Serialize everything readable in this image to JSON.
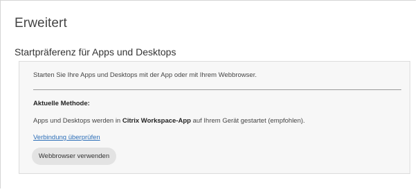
{
  "page": {
    "title": "Erweitert"
  },
  "section": {
    "title": "Startpräferenz für Apps und Desktops"
  },
  "panel": {
    "intro": "Starten Sie Ihre Apps und Desktops mit der App oder mit Ihrem Webbrowser.",
    "method_label": "Aktuelle Methode:",
    "method_text_prefix": "Apps und Desktops werden in ",
    "method_text_app": "Citrix Workspace-App",
    "method_text_suffix": " auf Ihrem Gerät gestartet (empfohlen).",
    "verify_link": "Verbindung überprüfen",
    "browser_button": "Webbrowser verwenden"
  },
  "colors": {
    "link": "#2d6fb8",
    "panel_background": "#f7f7f7",
    "button_background": "#e3e3e3"
  }
}
